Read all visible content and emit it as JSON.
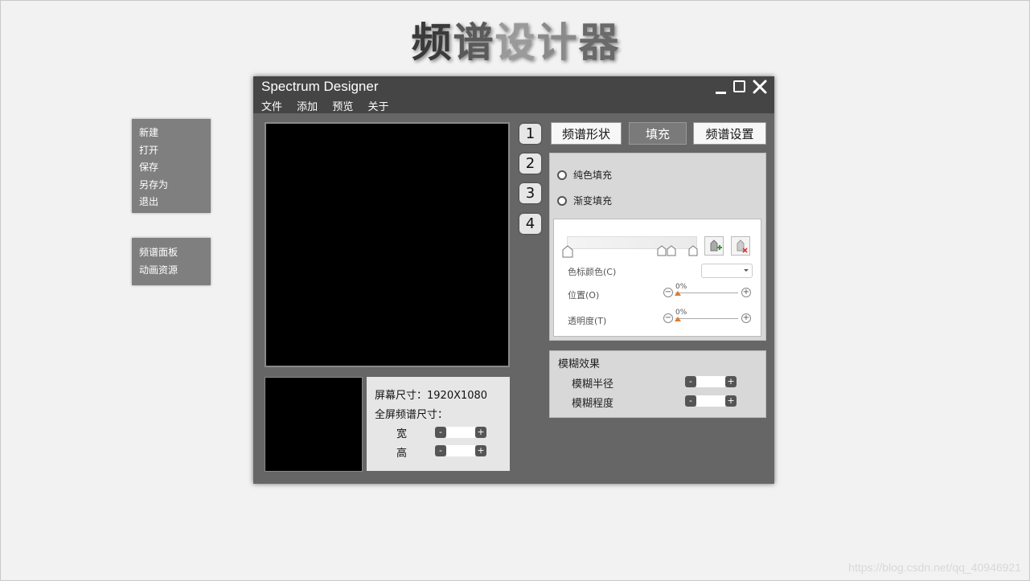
{
  "page_title_chars": [
    "频",
    "谱",
    "设",
    "计",
    "器"
  ],
  "side_menu_file": [
    "新建",
    "打开",
    "保存",
    "另存为",
    "退出"
  ],
  "side_menu_panels": [
    "频谱面板",
    "动画资源"
  ],
  "window": {
    "title": "Spectrum Designer",
    "menu": [
      "文件",
      "添加",
      "预览",
      "关于"
    ],
    "controls": {
      "minimize": "_",
      "maximize": "▢",
      "close": "✕"
    }
  },
  "screen_size": {
    "label": "屏幕尺寸：1920X1080",
    "fullscreen_label": "全屏频谱尺寸：",
    "width_label": "宽",
    "height_label": "高",
    "minus": "-",
    "plus": "+"
  },
  "steps": [
    "1",
    "2",
    "3",
    "4"
  ],
  "tabs": [
    {
      "label": "频谱形状",
      "active": false
    },
    {
      "label": "填充",
      "active": true
    },
    {
      "label": "频谱设置",
      "active": false
    }
  ],
  "fill": {
    "solid_label": "纯色填充",
    "gradient_label": "渐变填充",
    "stop_color_label": "色标颜色(C)",
    "position_label": "位置(O)",
    "position_value": "0%",
    "transparency_label": "透明度(T)",
    "transparency_value": "0%",
    "minus_symbol": "−",
    "plus_symbol": "+"
  },
  "blur": {
    "title": "模糊效果",
    "radius_label": "模糊半径",
    "degree_label": "模糊程度"
  },
  "watermark": "https://blog.csdn.net/qq_40946921",
  "colors": {
    "background": "#f2f2f2",
    "window": "#666666",
    "titlebar": "#454545",
    "accent_orange": "#e07b2c"
  }
}
